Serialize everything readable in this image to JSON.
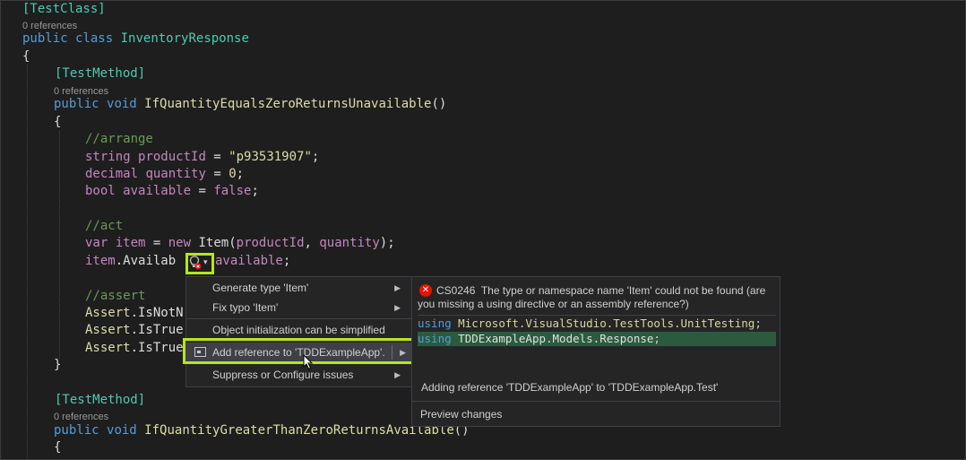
{
  "code": {
    "l1_attr": "[TestClass]",
    "refs1": "0 references",
    "l2_kw1": "public",
    "l2_kw2": "class",
    "l2_name": "InventoryResponse",
    "l3_brace": "{",
    "l4_attr": "[TestMethod]",
    "refs2": "0 references",
    "l5_kw1": "public",
    "l5_kw2": "void",
    "l5_name": "IfQuantityEqualsZeroReturnsUnavailable",
    "l5_parens": "()",
    "l6_brace": "{",
    "c_arrange": "//arrange",
    "l8_type": "string",
    "l8_var": "productId",
    "l8_eq": " = ",
    "l8_str": "\"p93531907\"",
    "l8_semi": ";",
    "l9_type": "decimal",
    "l9_var": "quantity",
    "l9_eq": " = ",
    "l9_num": "0",
    "l9_semi": ";",
    "l10_type": "bool",
    "l10_var": "available",
    "l10_eq": " = ",
    "l10_val": "false",
    "l10_semi": ";",
    "c_act": "//act",
    "l12_kw": "var",
    "l12_var": "item",
    "l12_eq": " = ",
    "l12_new": "new",
    "l12_type": "Item",
    "l12_args_open": "(",
    "l12_arg1": "productId",
    "l12_comma": ", ",
    "l12_arg2": "quantity",
    "l12_close": ");",
    "l13_var": "item",
    "l13_dot": ".",
    "l13_prop": "Availab",
    "l13_rest": "available",
    "l13_semi": ";",
    "c_assert": "//assert",
    "l15_a": "Assert",
    "l15_m": ".IsNotN",
    "l16_a": "Assert",
    "l16_m": ".IsTrue",
    "l17_a": "Assert",
    "l17_m": ".IsTrue",
    "l18_brace": "}",
    "l19_attr": "[TestMethod]",
    "refs3": "0 references",
    "l20_kw1": "public",
    "l20_kw2": "void",
    "l20_name": "IfQuantityGreaterThanZeroReturnsAvailable",
    "l20_parens": "()",
    "l21_brace": "{"
  },
  "lightbulb": {
    "icon": "lightbulb-error-icon",
    "chevron": "▾"
  },
  "menu": {
    "items": [
      {
        "label": "Generate type 'Item'",
        "arrow": "▶"
      },
      {
        "label": "Fix typo 'Item'",
        "arrow": "▶"
      },
      {
        "label": "Object initialization can be simplified",
        "arrow": ""
      },
      {
        "label": "Add reference to 'TDDExampleApp'.",
        "arrow": "▶"
      },
      {
        "label": "Suppress or Configure issues",
        "arrow": "▶"
      }
    ]
  },
  "preview": {
    "error_code": "CS0246",
    "error_message": "The type or namespace name 'Item' could not be found (are you missing a using directive or an assembly reference?)",
    "using_kw": "using",
    "line1_ns": "Microsoft.VisualStudio.TestTools.UnitTesting",
    "line2_ns": "TDDExampleApp.Models.Response",
    "semi": ";",
    "adding_text": "Adding reference 'TDDExampleApp' to 'TDDExampleApp.Test'",
    "preview_changes": "Preview changes"
  },
  "colors": {
    "highlight": "#b5e61d",
    "error": "#e51400",
    "added_line": "#2b5a3f"
  }
}
